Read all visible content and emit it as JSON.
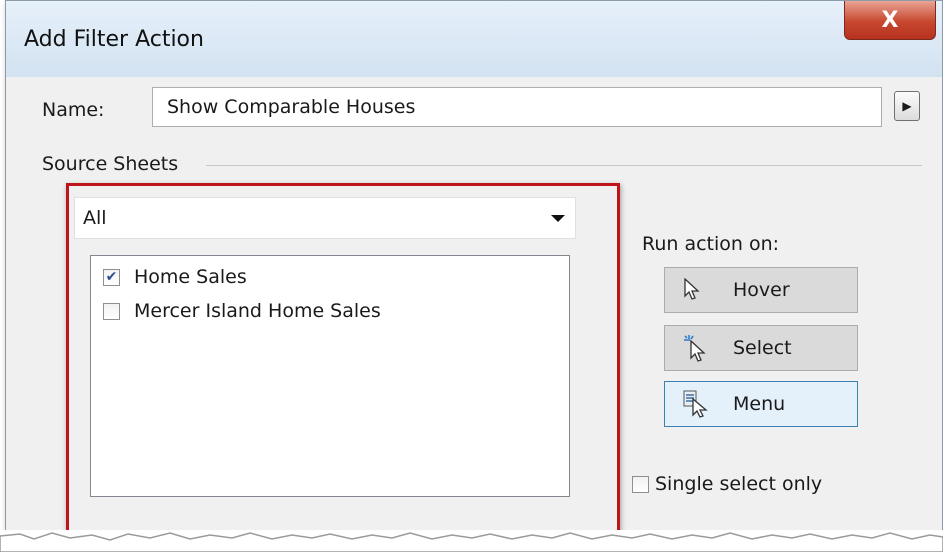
{
  "window": {
    "title": "Add Filter Action",
    "close_label": "X"
  },
  "name_field": {
    "label": "Name:",
    "value": "Show Comparable Houses",
    "arrow": "▶"
  },
  "source_sheets": {
    "group_label": "Source Sheets",
    "dropdown_value": "All",
    "items": [
      {
        "label": "Home Sales",
        "checked": true
      },
      {
        "label": "Mercer Island Home Sales",
        "checked": false
      }
    ]
  },
  "run_action": {
    "label": "Run action on:",
    "buttons": [
      {
        "label": "Hover",
        "icon": "pointer-icon",
        "active": false
      },
      {
        "label": "Select",
        "icon": "select-pointer-icon",
        "active": false
      },
      {
        "label": "Menu",
        "icon": "menu-pointer-icon",
        "active": true
      }
    ]
  },
  "single_select": {
    "label": "Single select only",
    "checked": false
  },
  "colors": {
    "highlight_border": "#c0141b",
    "active_button": "#e4f1fb"
  }
}
